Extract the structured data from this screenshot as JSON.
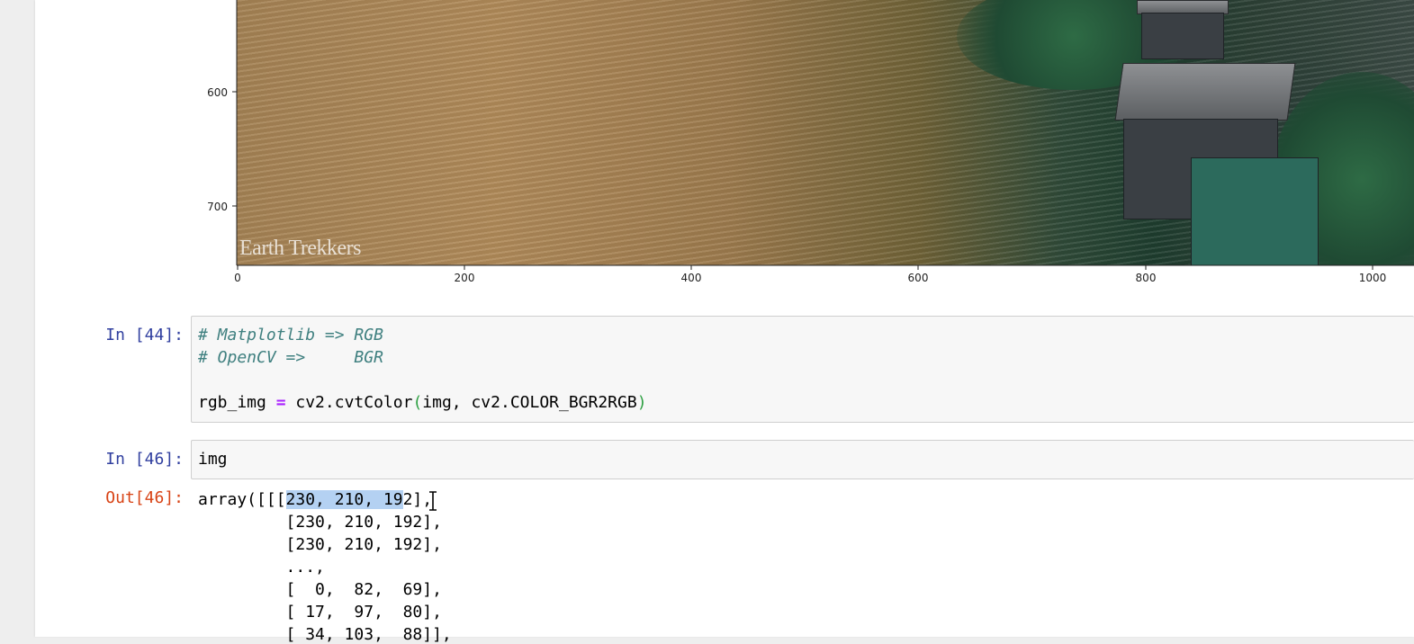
{
  "plot": {
    "watermark": "Earth Trekkers",
    "y_ticks": [
      "600",
      "700"
    ],
    "x_ticks": [
      "0",
      "200",
      "400",
      "600",
      "800",
      "1000"
    ]
  },
  "cell44": {
    "prompt": "In [44]:",
    "comment1": "# Matplotlib => RGB",
    "comment2": "# OpenCV =>     BGR",
    "code_lhs": "rgb_img ",
    "code_op": "=",
    "code_mid": " cv2.cvtColor",
    "code_open": "(",
    "code_args": "img, cv2.COLOR_BGR2RGB",
    "code_close": ")"
  },
  "cell46": {
    "prompt": "In [46]:",
    "code": "img",
    "out_prompt": "Out[46]:",
    "out_first_prefix": "array([[[",
    "out_first_selected": "230, 210, 19",
    "out_first_suffix": "2],",
    "out_lines": [
      "         [230, 210, 192],",
      "         [230, 210, 192],",
      "         ...,",
      "         [  0,  82,  69],",
      "         [ 17,  97,  80],",
      "         [ 34, 103,  88]],"
    ]
  },
  "colors": {
    "in_prompt": "#303f9f",
    "out_prompt": "#d84315",
    "comment": "#408080",
    "selection": "#b4d1f2"
  }
}
